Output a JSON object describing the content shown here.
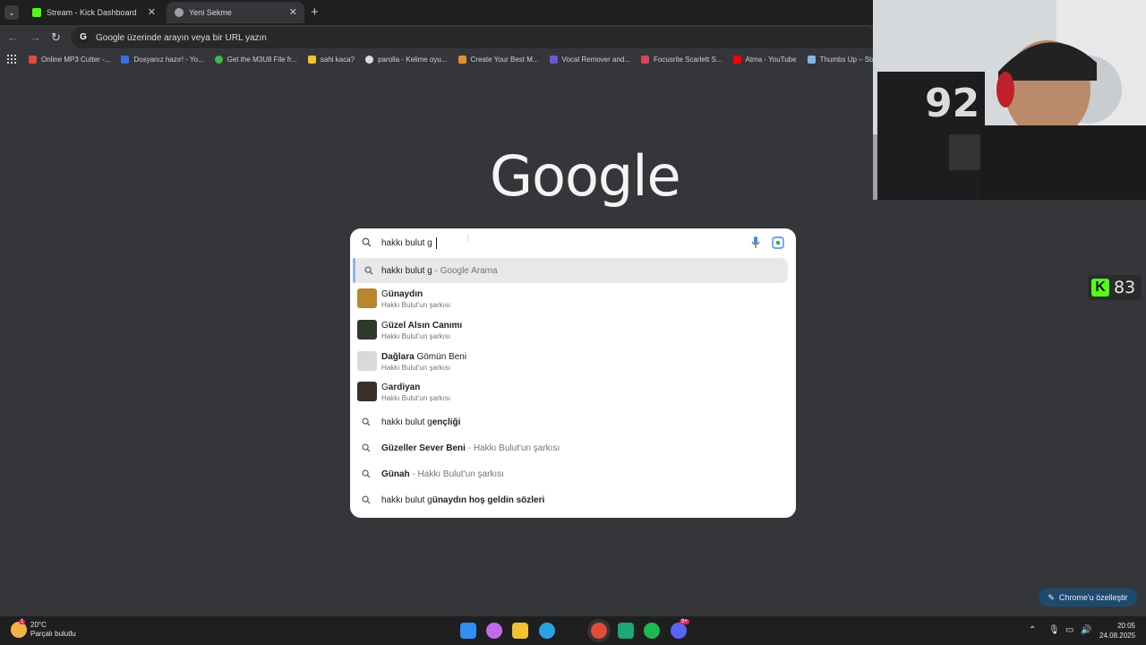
{
  "browser": {
    "tabs": [
      {
        "label": "Stream - Kick Dashboard",
        "active": false
      },
      {
        "label": "Yeni Sekme",
        "active": true
      }
    ],
    "omnibox_placeholder": "Google üzerinde arayın veya bir URL yazın",
    "bookmarks": [
      {
        "label": "Online MP3 Cutter -...",
        "color": "#e34b3a"
      },
      {
        "label": "Dosyanız hazır! - Yo...",
        "color": "#3b6fe0"
      },
      {
        "label": "Get the M3U8 File fr...",
        "color": "#3fb950"
      },
      {
        "label": "sahi kaca?",
        "color": "#f2c230"
      },
      {
        "label": "parolla - Kelime oyu...",
        "color": "#dddddd"
      },
      {
        "label": "Create Your Best M...",
        "color": "#e0902f"
      },
      {
        "label": "Vocal Remover and...",
        "color": "#6a5acd"
      },
      {
        "label": "Focusrite Scarlett S...",
        "color": "#d4455b"
      },
      {
        "label": "Atma - YouTube",
        "color": "#ff0000"
      },
      {
        "label": "Thumbs Up – Sta",
        "color": "#7fb6e8"
      }
    ]
  },
  "kick": {
    "viewer_count": "83"
  },
  "google": {
    "logo": "Google",
    "query": "hakkı bulut g",
    "suggestions": [
      {
        "type": "search",
        "bold": "",
        "plain": "hakkı bulut g",
        "muted": " - Google Arama",
        "highlighted": true
      },
      {
        "type": "song",
        "title_prefix": "G",
        "title_rest": "ünaydın",
        "subtitle": "Hakkı Bulut'un şarkısı",
        "thumb": "#b8862e"
      },
      {
        "type": "song",
        "title_prefix": "G",
        "title_rest": "üzel Alsın Canımı",
        "subtitle": "Hakkı Bulut'un şarkısı",
        "thumb": "#2b3a2a"
      },
      {
        "type": "song",
        "title_prefix": "Dağlara ",
        "title_rest": "Gömün Beni",
        "subtitle": "Hakkı Bulut'un şarkısı",
        "thumb": "#d9d9d9"
      },
      {
        "type": "song",
        "title_prefix": "G",
        "title_rest": "ardiyan",
        "subtitle": "Hakkı Bulut'un şarkısı",
        "thumb": "#3a2f2a"
      },
      {
        "type": "search",
        "plain": "hakkı bulut g",
        "bold": "ençliği",
        "muted": ""
      },
      {
        "type": "search",
        "plain": "G",
        "bold": "üzeller Sever Beni",
        "muted": " - Hakkı Bulut'un şarkısı"
      },
      {
        "type": "search",
        "plain": "G",
        "bold": "ünah",
        "muted": " - Hakkı Bulut'un şarkısı"
      },
      {
        "type": "search",
        "plain": "hakkı bulut g",
        "bold": "ünaydın hoş geldin sözleri",
        "muted": ""
      }
    ],
    "customize_label": "Chrome'u özelleştir"
  },
  "taskbar": {
    "weather_temp": "20°C",
    "weather_desc": "Parçalı bulutlu",
    "time": "20:05",
    "date": "24.08.2025",
    "discord_badge": "9+",
    "weather_badge": "1"
  }
}
